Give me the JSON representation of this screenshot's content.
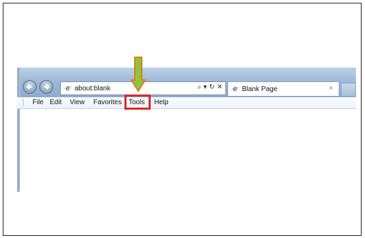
{
  "browser": {
    "address_url": "about:blank",
    "tab_title": "Blank Page",
    "tab_close": "×",
    "address_tools": {
      "search": "⌕",
      "dropdown": "▾",
      "refresh": "↻",
      "stop": "✕"
    }
  },
  "menu": {
    "items": [
      "File",
      "Edit",
      "View",
      "Favorites",
      "Tools",
      "Help"
    ]
  },
  "annotation": {
    "highlight_color": "#d8292b",
    "arrow_fill": "#8cc63f",
    "arrow_outline": "#e07a1f"
  }
}
